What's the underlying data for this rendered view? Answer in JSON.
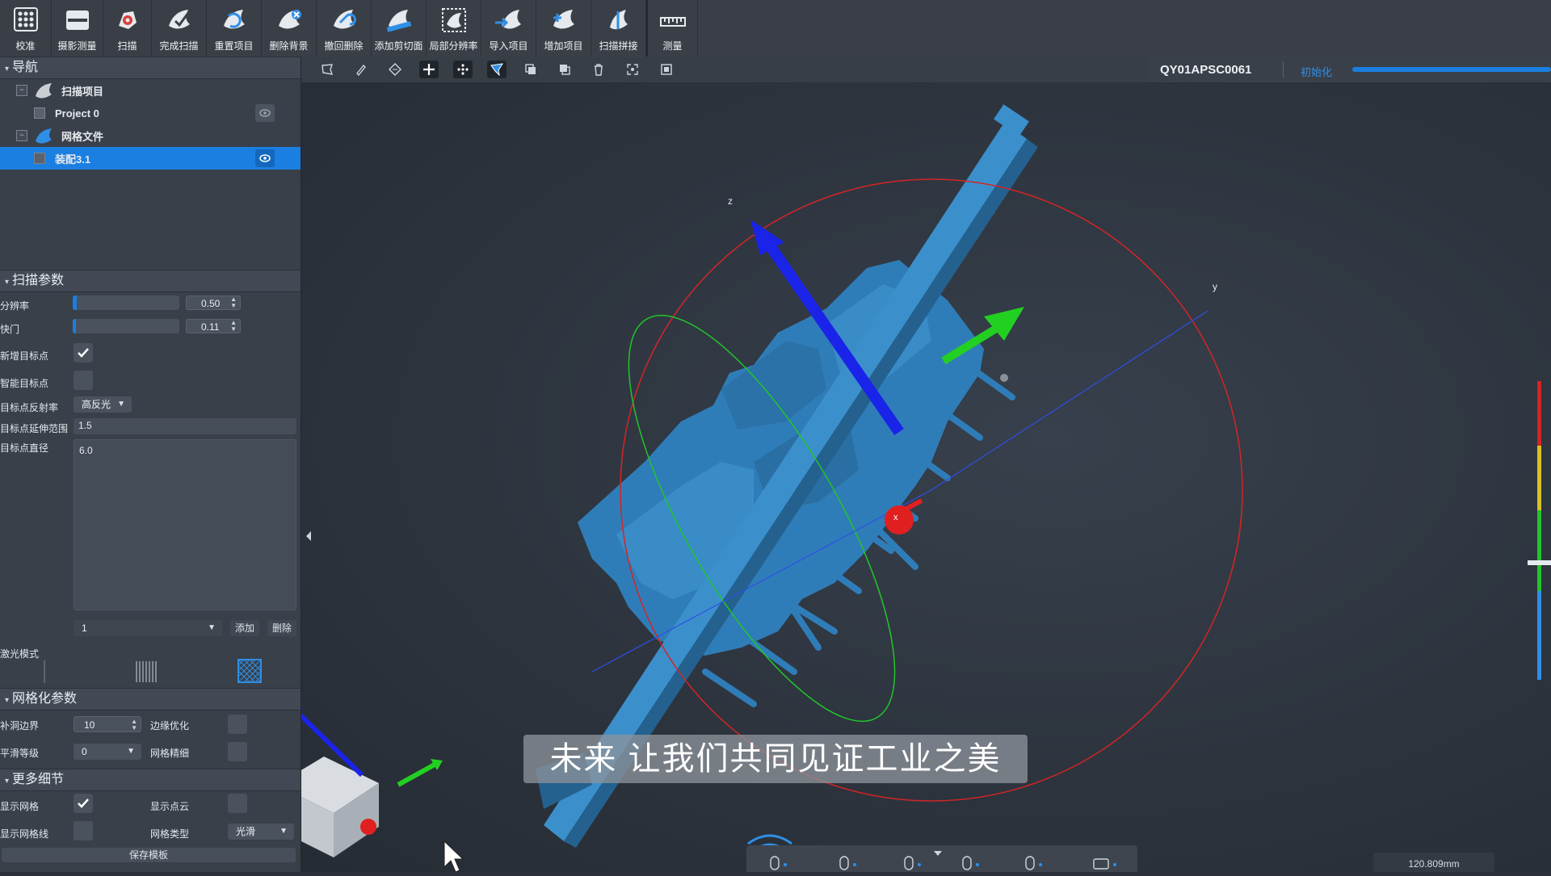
{
  "toolbar": [
    {
      "label": "校准",
      "icon": "calibrate-icon"
    },
    {
      "label": "摄影测量",
      "icon": "photogrammetry-icon"
    },
    {
      "label": "扫描",
      "icon": "scan-icon"
    },
    {
      "label": "完成扫描",
      "icon": "finish-scan-icon"
    },
    {
      "label": "重置项目",
      "icon": "reset-project-icon"
    },
    {
      "label": "删除背景",
      "icon": "delete-background-icon"
    },
    {
      "label": "撤回删除",
      "icon": "undo-delete-icon"
    },
    {
      "label": "添加剪切面",
      "icon": "add-clip-plane-icon"
    },
    {
      "label": "局部分辨率",
      "icon": "local-resolution-icon"
    },
    {
      "label": "导入项目",
      "icon": "import-project-icon"
    },
    {
      "label": "增加项目",
      "icon": "add-project-icon"
    },
    {
      "label": "扫描拼接",
      "icon": "scan-stitch-icon"
    },
    {
      "label": "测量",
      "icon": "measure-icon"
    }
  ],
  "nav": {
    "title": "导航",
    "scan_project": "扫描项目",
    "project": "Project 0",
    "mesh_file": "网格文件",
    "mesh_item": "装配3.1"
  },
  "scan_params": {
    "title": "扫描参数",
    "resolution_label": "分辨率",
    "resolution_value": "0.50",
    "resolution_fraction": 0.04,
    "exposure_label": "快门",
    "exposure_value": "0.11",
    "exposure_fraction": 0.03,
    "new_target_label": "新增目标点",
    "new_target_checked": true,
    "smart_target_label": "智能目标点",
    "smart_target_checked": false,
    "reflectivity_label": "目标点反射率",
    "reflectivity_value": "高反光",
    "extend_range_label": "目标点延伸范围",
    "extend_range_value": "1.5",
    "diameter_label": "目标点直径",
    "diameter_value": "6.0",
    "list_value": "1",
    "add_label": "添加",
    "delete_label": "删除",
    "laser_mode_label": "激光模式"
  },
  "mesh_params": {
    "title": "网格化参数",
    "fill_border_label": "补洞边界",
    "fill_border_value": "10",
    "edge_opt_label": "边缘优化",
    "smooth_label": "平滑等级",
    "smooth_value": "0",
    "mesh_fine_label": "网格精细"
  },
  "more": {
    "title": "更多细节",
    "show_mesh_label": "显示网格",
    "show_mesh_checked": true,
    "show_points_label": "显示点云",
    "show_wire_label": "显示网格线",
    "mesh_type_label": "网格类型",
    "mesh_type_value": "光滑",
    "save_template_label": "保存模板"
  },
  "status": {
    "device": "QY01APSC0061",
    "state": "初始化",
    "progress": 1.0
  },
  "viewport": {
    "axis_z": "z",
    "axis_y": "y",
    "axis_x": "x",
    "subtitle": "未来  让我们共同见证工业之美",
    "scale_readout": "120.809mm"
  },
  "colors": {
    "accent": "#1a7fe0",
    "model": "#2f7db8",
    "axis_x": "#e02020",
    "axis_y": "#22d022",
    "axis_z": "#1a24e8"
  }
}
